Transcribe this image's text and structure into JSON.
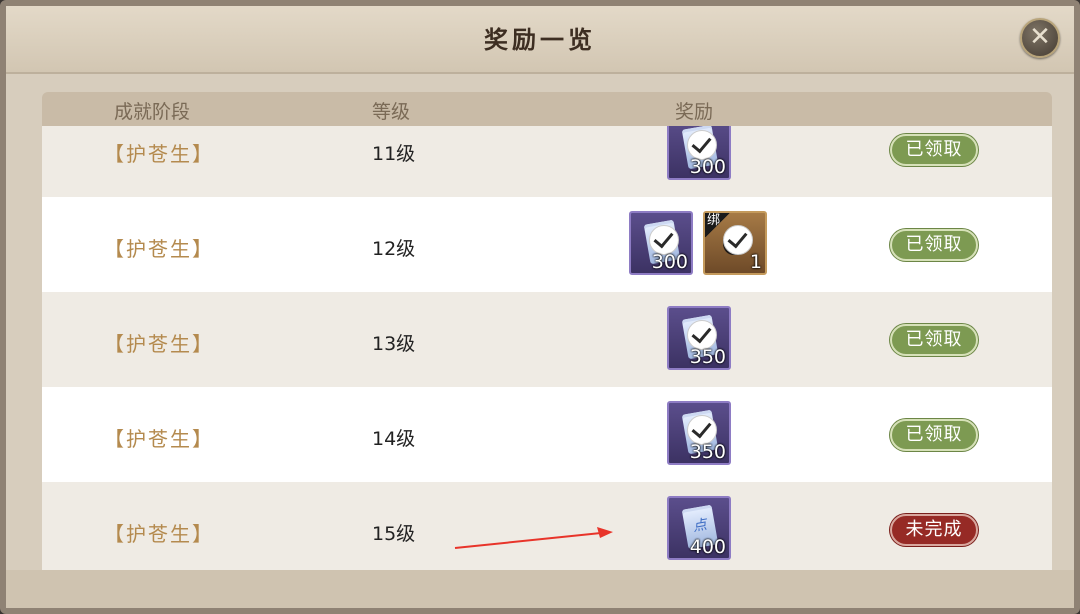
{
  "title": "奖励一览",
  "close_icon": "✕",
  "columns": {
    "stage": "成就阶段",
    "level": "等级",
    "reward": "奖励"
  },
  "rows": [
    {
      "stage": "【护苍生】",
      "level": "11级",
      "rewards": [
        {
          "icon": "scroll-icon",
          "qty": "300",
          "claimed": true
        }
      ],
      "status": "已领取",
      "status_type": "done"
    },
    {
      "stage": "【护苍生】",
      "level": "12级",
      "rewards": [
        {
          "icon": "scroll-icon",
          "qty": "300",
          "claimed": true
        },
        {
          "icon": "character-head-icon",
          "qty": "1",
          "claimed": true,
          "tag": "绑"
        }
      ],
      "status": "已领取",
      "status_type": "done"
    },
    {
      "stage": "【护苍生】",
      "level": "13级",
      "rewards": [
        {
          "icon": "scroll-icon",
          "qty": "350",
          "claimed": true
        }
      ],
      "status": "已领取",
      "status_type": "done"
    },
    {
      "stage": "【护苍生】",
      "level": "14级",
      "rewards": [
        {
          "icon": "scroll-icon",
          "qty": "350",
          "claimed": true
        }
      ],
      "status": "已领取",
      "status_type": "done"
    },
    {
      "stage": "【护苍生】",
      "level": "15级",
      "rewards": [
        {
          "icon": "scroll-icon",
          "qty": "400",
          "claimed": false,
          "glyph": "点"
        }
      ],
      "status": "未完成",
      "status_type": "pending"
    }
  ],
  "colors": {
    "done": "#7d9a52",
    "pending": "#962a25",
    "arrow": "#e8342a"
  }
}
